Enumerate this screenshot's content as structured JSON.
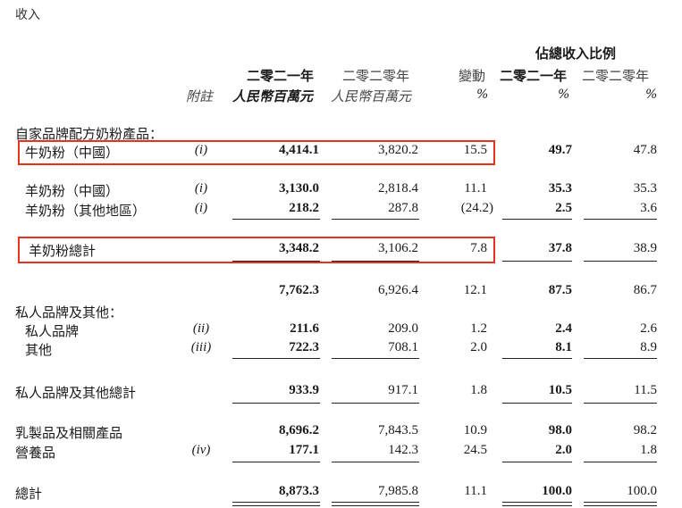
{
  "section_title": "收入",
  "headers": {
    "group": "佔總收入比例",
    "col_note": "附註",
    "col_2021": [
      "二零二一年",
      "人民幣百萬元"
    ],
    "col_2020": [
      "二零二零年",
      "人民幣百萬元"
    ],
    "col_change": [
      "變動",
      "%"
    ],
    "col_pct_2021": [
      "二零二一年",
      "%"
    ],
    "col_pct_2020": [
      "二零二零年",
      "%"
    ]
  },
  "group_labels": {
    "self_brand": "自家品牌配方奶粉產品：",
    "private": "私人品牌及其他："
  },
  "rows": [
    {
      "label": "牛奶粉（中國）",
      "note": "(i)",
      "v2021": "4,414.1",
      "v2020": "3,820.2",
      "chg": "15.5",
      "p2021": "49.7",
      "p2020": "47.8"
    },
    {
      "label": "羊奶粉（中國）",
      "note": "(i)",
      "v2021": "3,130.0",
      "v2020": "2,818.4",
      "chg": "11.1",
      "p2021": "35.3",
      "p2020": "35.3"
    },
    {
      "label": "羊奶粉（其他地區）",
      "note": "(i)",
      "v2021": "218.2",
      "v2020": "287.8",
      "chg": "(24.2)",
      "p2021": "2.5",
      "p2020": "3.6"
    },
    {
      "label": "羊奶粉總計",
      "note": "",
      "v2021": "3,348.2",
      "v2020": "3,106.2",
      "chg": "7.8",
      "p2021": "37.8",
      "p2020": "38.9"
    },
    {
      "label": "",
      "note": "",
      "v2021": "7,762.3",
      "v2020": "6,926.4",
      "chg": "12.1",
      "p2021": "87.5",
      "p2020": "86.7"
    },
    {
      "label": "私人品牌",
      "note": "(ii)",
      "v2021": "211.6",
      "v2020": "209.0",
      "chg": "1.2",
      "p2021": "2.4",
      "p2020": "2.6"
    },
    {
      "label": "其他",
      "note": "(iii)",
      "v2021": "722.3",
      "v2020": "708.1",
      "chg": "2.0",
      "p2021": "8.1",
      "p2020": "8.9"
    },
    {
      "label": "私人品牌及其他總計",
      "note": "",
      "v2021": "933.9",
      "v2020": "917.1",
      "chg": "1.8",
      "p2021": "10.5",
      "p2020": "11.5"
    },
    {
      "label": "乳製品及相關產品",
      "note": "",
      "v2021": "8,696.2",
      "v2020": "7,843.5",
      "chg": "10.9",
      "p2021": "98.0",
      "p2020": "98.2"
    },
    {
      "label": "營養品",
      "note": "(iv)",
      "v2021": "177.1",
      "v2020": "142.3",
      "chg": "24.5",
      "p2021": "2.0",
      "p2020": "1.8"
    },
    {
      "label": "總計",
      "note": "",
      "v2021": "8,873.3",
      "v2020": "7,985.8",
      "chg": "11.1",
      "p2021": "100.0",
      "p2020": "100.0"
    }
  ],
  "highlight_color": "#e8321c"
}
